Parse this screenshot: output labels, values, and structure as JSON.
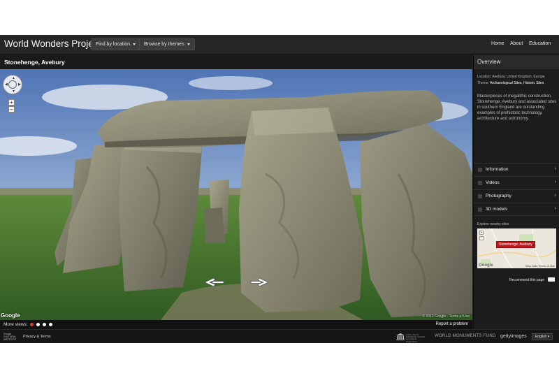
{
  "header": {
    "app_title": "World Wonders Project",
    "find_by_location": "Find by location",
    "browse_by_themes": "Browse by themes",
    "links": [
      "Home",
      "About",
      "Education"
    ]
  },
  "place": {
    "title": "Stonehenge, Avebury"
  },
  "viewer": {
    "zoom_in": "+",
    "zoom_out": "−",
    "logo": "Google",
    "copyright": "© 2012 Google · Terms of Use"
  },
  "more_views": {
    "label": "More views:",
    "dots": 4,
    "active_color": "#d9453b",
    "report": "Report a problem"
  },
  "panel": {
    "overview_title": "Overview",
    "location_label": "Location:",
    "location_value": "Avebury, United Kingdom, Europe",
    "theme_label": "Theme:",
    "theme_value": "Archaeological Sites, Historic Sites",
    "description": "Masterpieces of megalithic construction, Stonehenge, Avebury and associated sites in southern England are outstanding examples of prehistoric technology, architecture and astronomy.",
    "sections": [
      "Information",
      "Videos",
      "Photography",
      "3D models"
    ],
    "nearby_label": "Explore nearby sites",
    "map_label": "Stonehenge, Avebury",
    "map_logo": "Google",
    "map_terms": "Map Data   Terms of Use",
    "recommend": "Recommend this page"
  },
  "footer": {
    "institute": "Google\nCULTURAL\nINSTITUTE",
    "privacy": "Privacy & Terms",
    "unesco_text": "United Nations Educational, Scientific and Cultural Organization",
    "wmf": "WORLD MONUMENTS FUND",
    "getty": "gettyimages",
    "language": "English ▾"
  },
  "colors": {
    "accent_marker": "#c1161b",
    "bar_dark": "#1e1e1e"
  }
}
